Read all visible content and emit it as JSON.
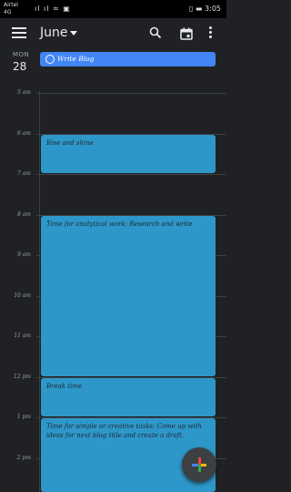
{
  "status_bar": {
    "carrier_line1": "Airtel",
    "carrier_line2": "4G",
    "signal": "ıl ıl ≈ ▣",
    "right": "▯ ▬ 3:05"
  },
  "app_bar": {
    "month": "June"
  },
  "day_header": {
    "weekday": "MON",
    "day": "28",
    "all_day_event": "Write Blog"
  },
  "hours": [
    "5 am",
    "6 am",
    "7 am",
    "8 am",
    "9 am",
    "10 am",
    "11 am",
    "12 pm",
    "1 pm",
    "2 pm"
  ],
  "events": [
    {
      "title": "Rise and shine",
      "start": "6:00",
      "end": "7:00"
    },
    {
      "title": "Time for analytical work: Research and write",
      "start": "8:00",
      "end": "12:00"
    },
    {
      "title": "Break time",
      "start": "12:00",
      "end": "13:00"
    },
    {
      "title": "Time for simple or creative tasks: Come up with ideas for next blog title and create a draft.",
      "start": "13:00",
      "end": "15:00"
    }
  ],
  "colors": {
    "event": "#2e97c9",
    "all_day": "#4285f4",
    "background": "#202124"
  },
  "icons": {
    "menu": "menu-icon",
    "search": "search-icon",
    "today": "calendar-today-icon",
    "more": "more-vert-icon",
    "fab": "add-icon"
  }
}
